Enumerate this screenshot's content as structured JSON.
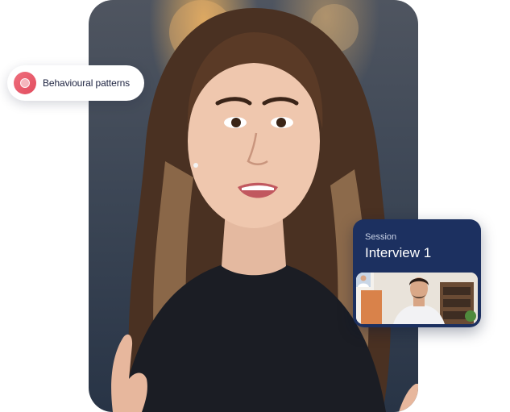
{
  "badge": {
    "label": "Behavioural patterns",
    "icon": "pattern-icon",
    "accent": "#e85468"
  },
  "session_card": {
    "kicker": "Session",
    "title": "Interview 1",
    "background": "#1c3060"
  },
  "video": {
    "subject": "speaker-portrait"
  }
}
